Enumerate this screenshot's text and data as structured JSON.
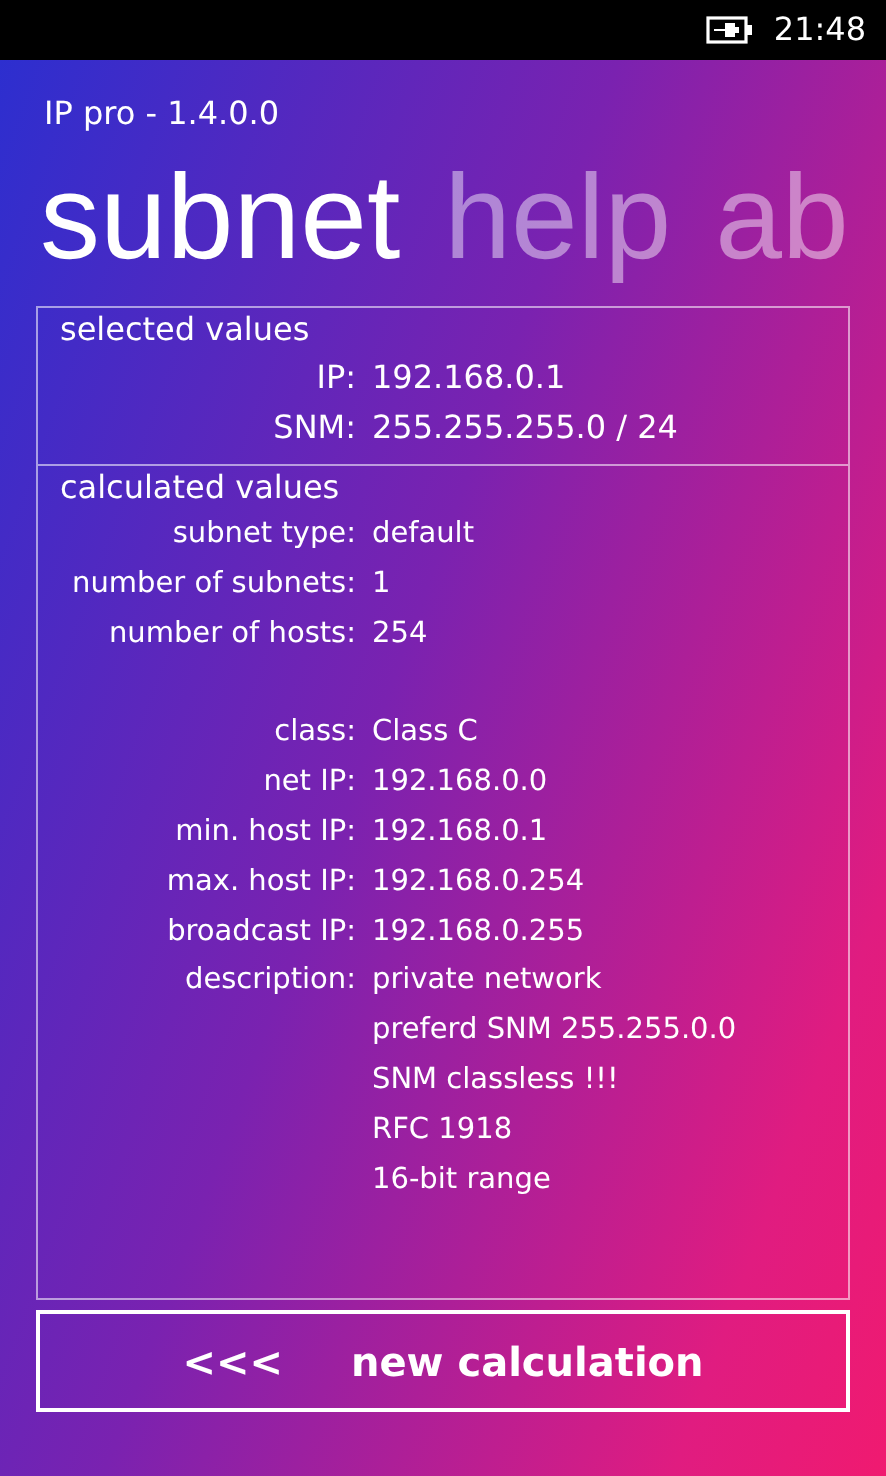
{
  "status_bar": {
    "time": "21:48"
  },
  "app_title": "IP pro - 1.4.0.0",
  "pivot": [
    {
      "label": "subnet",
      "selected": true
    },
    {
      "label": "help",
      "selected": false
    },
    {
      "label": "ab",
      "selected": false
    }
  ],
  "selected_values": {
    "heading": "selected values",
    "groups": [
      [
        {
          "label": "IP:",
          "values": [
            "192.168.0.1"
          ]
        },
        {
          "label": "SNM:",
          "values": [
            "255.255.255.0 / 24"
          ]
        }
      ]
    ]
  },
  "calculated_values": {
    "heading": "calculated values",
    "groups": [
      [
        {
          "label": "subnet type:",
          "values": [
            "default"
          ]
        },
        {
          "label": "number of subnets:",
          "values": [
            "1"
          ]
        },
        {
          "label": "number of hosts:",
          "values": [
            "254"
          ]
        }
      ],
      [
        {
          "label": "class:",
          "values": [
            "Class C"
          ]
        },
        {
          "label": "net IP:",
          "values": [
            "192.168.0.0"
          ]
        },
        {
          "label": "min. host IP:",
          "values": [
            "192.168.0.1"
          ]
        },
        {
          "label": "max. host IP:",
          "values": [
            "192.168.0.254"
          ]
        },
        {
          "label": "broadcast IP:",
          "values": [
            "192.168.0.255"
          ]
        },
        {
          "label": "description:",
          "values": [
            "private network",
            "preferd SNM 255.255.0.0",
            "SNM classless !!!",
            "RFC 1918",
            "16-bit range"
          ]
        }
      ]
    ]
  },
  "button": {
    "arrows": "<<<",
    "label": "new calculation"
  }
}
